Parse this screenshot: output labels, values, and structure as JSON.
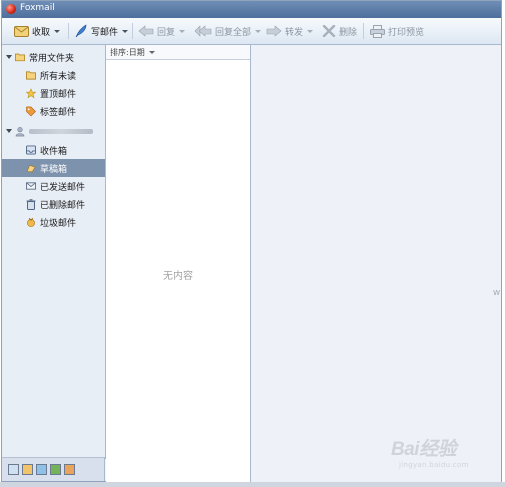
{
  "window": {
    "title": "Foxmail"
  },
  "toolbar": {
    "receive": "收取",
    "compose": "写邮件",
    "reply": "回复",
    "reply_all": "回复全部",
    "forward": "转发",
    "delete": "删除",
    "print_preview": "打印预览"
  },
  "sidebar": {
    "common_folders": "常用文件夹",
    "all_unread": "所有未读",
    "starred": "置顶邮件",
    "tagged": "标签邮件",
    "inbox": "收件箱",
    "drafts": "草稿箱",
    "sent": "已发送邮件",
    "deleted": "已删除邮件",
    "junk": "垃圾邮件"
  },
  "list": {
    "sort_label": "排序:日期",
    "empty_text": "无内容"
  },
  "reading": {
    "edge_text": "W"
  },
  "watermark": {
    "main": "Bai经验",
    "sub": "jingyan.baidu.com"
  },
  "colors": {
    "selected_row": "#7d92ad",
    "titlebar": "#5a7aa6",
    "accent_red": "#d32515"
  }
}
